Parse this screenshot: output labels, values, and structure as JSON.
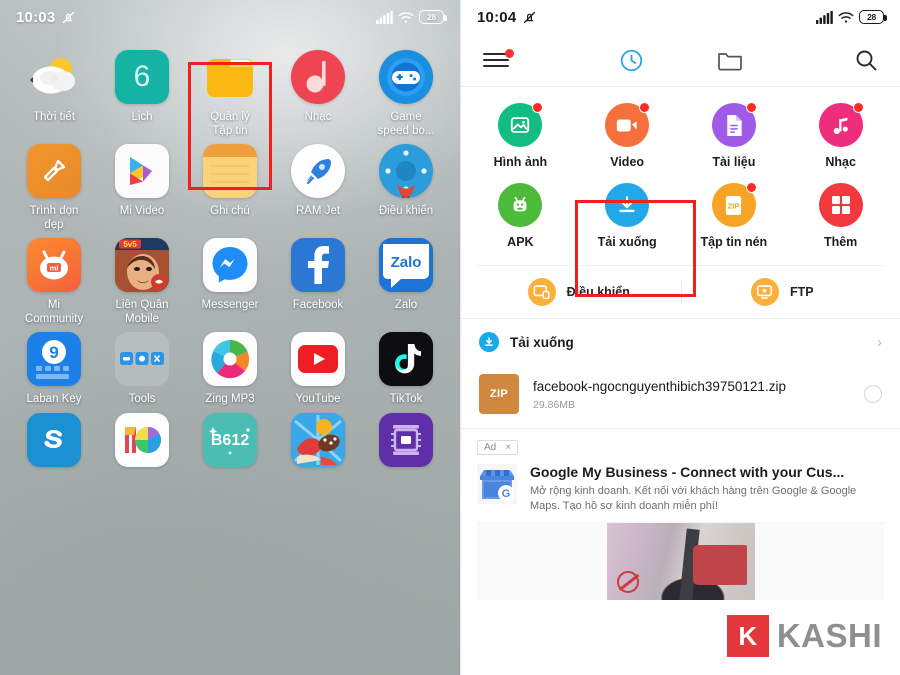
{
  "left_phone": {
    "status_bar": {
      "time": "10:03",
      "mute_icon": "mute-bell-icon",
      "signal": "signal-bars-icon",
      "wifi": "wifi-icon",
      "battery_level": "28"
    },
    "apps": [
      {
        "label": "Thời tiết",
        "icon": "weather-icon"
      },
      {
        "label": "Lịch",
        "icon": "calendar-icon",
        "day": "6"
      },
      {
        "label": "Quản lý\nTập tin",
        "icon": "file-manager-folder-icon",
        "highlighted": true
      },
      {
        "label": "Nhạc",
        "icon": "music-note-icon"
      },
      {
        "label": "Game\nspeed bo...",
        "icon": "gamepad-icon"
      },
      {
        "label": "Trình dọn\ndẹp",
        "icon": "cleaner-brush-icon"
      },
      {
        "label": "Mi Video",
        "icon": "mi-video-play-icon"
      },
      {
        "label": "Ghi chú",
        "icon": "notes-icon"
      },
      {
        "label": "RAM Jet",
        "icon": "rocket-icon"
      },
      {
        "label": "Điều khiển",
        "icon": "remote-control-icon"
      },
      {
        "label": "Mi\nCommunity",
        "icon": "mi-community-icon"
      },
      {
        "label": "Liên Quân\nMobile",
        "icon": "lien-quan-mobile-icon"
      },
      {
        "label": "Messenger",
        "icon": "messenger-icon"
      },
      {
        "label": "Facebook",
        "icon": "facebook-icon"
      },
      {
        "label": "Zalo",
        "icon": "zalo-icon"
      },
      {
        "label": "Laban Key",
        "icon": "laban-key-icon"
      },
      {
        "label": "Tools",
        "icon": "tools-folder-icon"
      },
      {
        "label": "Zing MP3",
        "icon": "zing-mp3-icon"
      },
      {
        "label": "YouTube",
        "icon": "youtube-icon"
      },
      {
        "label": "TikTok",
        "icon": "tiktok-icon"
      },
      {
        "label": "",
        "icon": "skype-icon"
      },
      {
        "label": "",
        "icon": "miui-themes-icon"
      },
      {
        "label": "",
        "icon": "b612-camera-icon"
      },
      {
        "label": "",
        "icon": "candy-crush-icon"
      },
      {
        "label": "",
        "icon": "cpu-z-icon"
      }
    ]
  },
  "right_phone": {
    "status_bar": {
      "time": "10:04",
      "mute_icon": "mute-bell-icon",
      "signal": "signal-bars-icon",
      "wifi": "wifi-icon",
      "battery_level": "28"
    },
    "toolbar": {
      "menu": "hamburger-menu-icon",
      "recent": "recent-clock-icon",
      "folders": "folder-icon",
      "search": "search-icon"
    },
    "categories": [
      {
        "label": "Hình ảnh",
        "icon": "image-icon",
        "color": "#11bd7f",
        "badge": true
      },
      {
        "label": "Video",
        "icon": "video-icon",
        "color": "#f5703c",
        "badge": true
      },
      {
        "label": "Tài liệu",
        "icon": "document-icon",
        "color": "#a05ae8",
        "badge": true
      },
      {
        "label": "Nhạc",
        "icon": "music-icon",
        "color": "#ef2d7d",
        "badge": true
      },
      {
        "label": "APK",
        "icon": "android-apk-icon",
        "color": "#4cbb3a",
        "badge": false
      },
      {
        "label": "Tải xuống",
        "icon": "download-icon",
        "color": "#22a7e8",
        "badge": false,
        "highlighted": true
      },
      {
        "label": "Tập tin nén",
        "icon": "zip-archive-icon",
        "color": "#f7a426",
        "badge": true
      },
      {
        "label": "Thêm",
        "icon": "more-grid-icon",
        "color": "#f1393f",
        "badge": false
      }
    ],
    "actions": [
      {
        "label": "Điều khiển",
        "icon": "remote-cast-icon"
      },
      {
        "label": "FTP",
        "icon": "ftp-monitor-icon"
      }
    ],
    "section": {
      "title": "Tải xuống",
      "icon": "download-circle-icon",
      "chevron": "chevron-right-icon"
    },
    "file": {
      "type_label": "ZIP",
      "name": "facebook-ngocnguyenthibich39750121.zip",
      "size": "29.86MB",
      "checkbox": "unchecked"
    },
    "ad": {
      "tag": "Ad",
      "close": "×",
      "logo": "google-my-business-icon",
      "title": "Google My Business - Connect with your Cus...",
      "description": "Mở rộng kinh doanh. Kết nối với khách hàng trên Google & Google Maps. Tạo hồ sơ kinh doanh miễn phí!"
    }
  },
  "watermark": {
    "mark": "K",
    "text": "KASHI"
  },
  "theme": {
    "accent_blue": "#22a7e8",
    "highlight_red": "#f21f1f",
    "badge_red": "#fb2c24",
    "orange": "#fbb03b"
  }
}
